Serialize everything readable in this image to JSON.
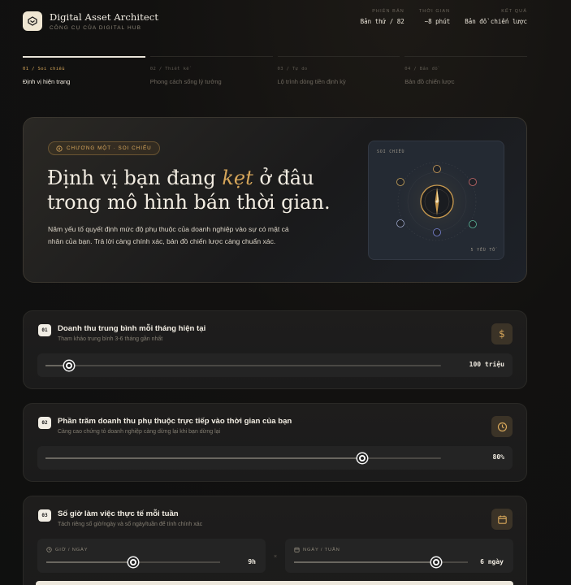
{
  "brand": {
    "title": "Digital Asset Architect",
    "subtitle": "CÔNG CỤ CỦA DIGITAL HUB"
  },
  "meta": [
    {
      "label": "PHIÊN BẢN",
      "value": "Bản thứ / 82"
    },
    {
      "label": "THỜI GIAN",
      "value": "~8 phút"
    },
    {
      "label": "KẾT QUẢ",
      "value": "Bản đồ chiến lược"
    }
  ],
  "steps": [
    {
      "num": "01 / Soi chiếu",
      "label": "Định vị hiện trạng",
      "active": true
    },
    {
      "num": "02 / Thiết kế",
      "label": "Phong cách sống lý tưởng",
      "active": false
    },
    {
      "num": "03 / Tự do",
      "label": "Lộ trình dòng tiền định kỳ",
      "active": false
    },
    {
      "num": "04 / Bản đồ",
      "label": "Bản đồ chiến lược",
      "active": false
    }
  ],
  "hero": {
    "chapter": "CHƯƠNG MỘT · SOI CHIẾU",
    "title_before": "Định vị bạn đang ",
    "title_em": "kẹt",
    "title_after": " ở đâu trong mô hình bán thời gian.",
    "description": "Năm yếu tố quyết định mức độ phụ thuộc của doanh nghiệp vào sự có mặt cá nhân của bạn. Trả lời càng chính xác, bản đồ chiến lược càng chuẩn xác.",
    "compass_label": "SOI CHIẾU",
    "compass_foot": "5 YẾU TỐ"
  },
  "questions": [
    {
      "num": "01",
      "title": "Doanh thu trung bình mỗi tháng hiện tại",
      "hint": "Tham khảo trung bình 3-6 tháng gần nhất",
      "icon": "dollar-icon",
      "value": "100 triệu",
      "level": 0.06
    },
    {
      "num": "02",
      "title": "Phần trăm doanh thu phụ thuộc trực tiếp vào thời gian của bạn",
      "hint": "Càng cao chứng tỏ doanh nghiệp càng dừng lại khi bạn dừng lại",
      "icon": "clock-icon",
      "value": "80%",
      "level": 0.8
    },
    {
      "num": "03",
      "title": "Số giờ làm việc thực tế mỗi tuần",
      "hint": "Tách riêng số giờ/ngày và số ngày/tuần để tính chính xác",
      "icon": "calendar-icon",
      "hours_label": "GIỜ / NGÀY",
      "hours_value": "9h",
      "hours_level": 0.5,
      "days_label": "NGÀY / TUẦN",
      "days_value": "6 ngày",
      "days_level": 0.82,
      "times": "×"
    }
  ],
  "colors": {
    "accent": "#d6a65a",
    "background": "#121110"
  }
}
